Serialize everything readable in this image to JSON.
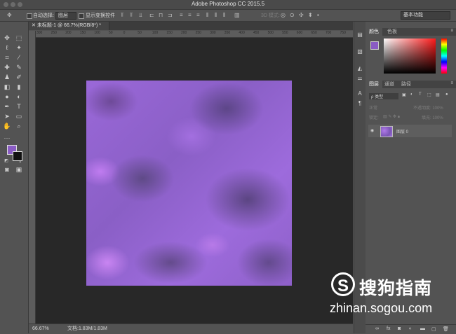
{
  "window": {
    "title": "Adobe Photoshop CC 2015.5"
  },
  "options_bar": {
    "auto_select_label": "自动选择:",
    "auto_select_value": "图层",
    "show_transform_label": "显示变换控件",
    "mode_3d_label": "3D 模式:",
    "workspace": "基本功能"
  },
  "document": {
    "tab_label": "未标题-1 @ 66.7%(RGB/8*) *",
    "ruler_ticks": [
      "300",
      "250",
      "200",
      "150",
      "100",
      "50",
      "0",
      "50",
      "100",
      "150",
      "200",
      "250",
      "300",
      "350",
      "400",
      "450",
      "500",
      "550",
      "600",
      "650",
      "700",
      "750"
    ]
  },
  "tools": {
    "fg_color": "#8a5cc4",
    "bg_color": "#111111",
    "icons": [
      "move-icon",
      "marquee-icon",
      "lasso-icon",
      "magic-wand-icon",
      "crop-icon",
      "eyedropper-icon",
      "healing-icon",
      "brush-icon",
      "stamp-icon",
      "history-brush-icon",
      "eraser-icon",
      "gradient-icon",
      "blur-icon",
      "dodge-icon",
      "pen-icon",
      "type-icon",
      "path-select-icon",
      "shape-icon",
      "hand-icon",
      "zoom-icon",
      "more-icon"
    ]
  },
  "status": {
    "zoom": "66.67%",
    "doc_info": "文档:1.83M/1.83M"
  },
  "color_panel": {
    "tabs": [
      "颜色",
      "色板"
    ],
    "active_color": "#8a5cc4"
  },
  "layers_panel": {
    "tabs": [
      "图层",
      "通道",
      "路径"
    ],
    "filter_label": "ρ 类型",
    "blend_mode": "正常",
    "opacity_label": "不透明度: 100%",
    "lock_label": "锁定:",
    "fill_label": "填充: 100%",
    "layer_name": "图层 0",
    "footer_icons": [
      "link-icon",
      "fx-icon",
      "mask-icon",
      "adjustment-icon",
      "group-icon",
      "new-layer-icon",
      "trash-icon"
    ],
    "footer_labels": [
      "∞",
      "fx"
    ]
  },
  "watermark": {
    "logo_glyph": "S",
    "name": "搜狗指南",
    "url": "zhinan.sogou.com"
  }
}
